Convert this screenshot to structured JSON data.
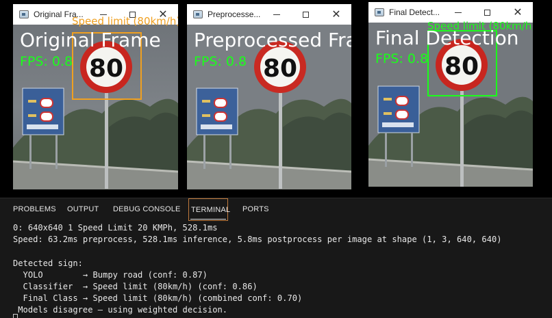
{
  "windows": [
    {
      "title": "Original Fra...",
      "overlay_title": "Original Frame",
      "fps": "FPS: 0.8",
      "detection_label": "Speed limit (80km/h)",
      "sign_number": "80"
    },
    {
      "title": "Preprocesse...",
      "overlay_title": "Preprocessed Frame",
      "fps": "FPS: 0.8",
      "sign_number": "80"
    },
    {
      "title": "Final Detect...",
      "overlay_title": "Final Detection",
      "fps": "FPS: 0.8",
      "detection_label": "Speed limit (80km/h)",
      "sign_number": "80"
    }
  ],
  "window_controls": {
    "minimize": "—",
    "maximize": "☐",
    "close": "✕"
  },
  "panel": {
    "tabs": [
      "PROBLEMS",
      "OUTPUT",
      "DEBUG CONSOLE",
      "TERMINAL",
      "PORTS"
    ],
    "active_tab": "TERMINAL",
    "terminal_lines": [
      "0: 640x640 1 Speed Limit 20 KMPh, 528.1ms",
      "Speed: 63.2ms preprocess, 528.1ms inference, 5.8ms postprocess per image at shape (1, 3, 640, 640)",
      "",
      "Detected sign:",
      "  YOLO        → Bumpy road (conf: 0.87)",
      "  Classifier  → Speed limit (80km/h) (conf: 0.86)",
      "  Final Class → Speed limit (80km/h) (combined conf: 0.70)",
      " Models disagree — using weighted decision."
    ]
  },
  "colors": {
    "yolo_box": "#f0a020",
    "final_box": "#1aff1a",
    "fps_text": "#1aff1a",
    "active_tab_border": "#c07a3c"
  }
}
